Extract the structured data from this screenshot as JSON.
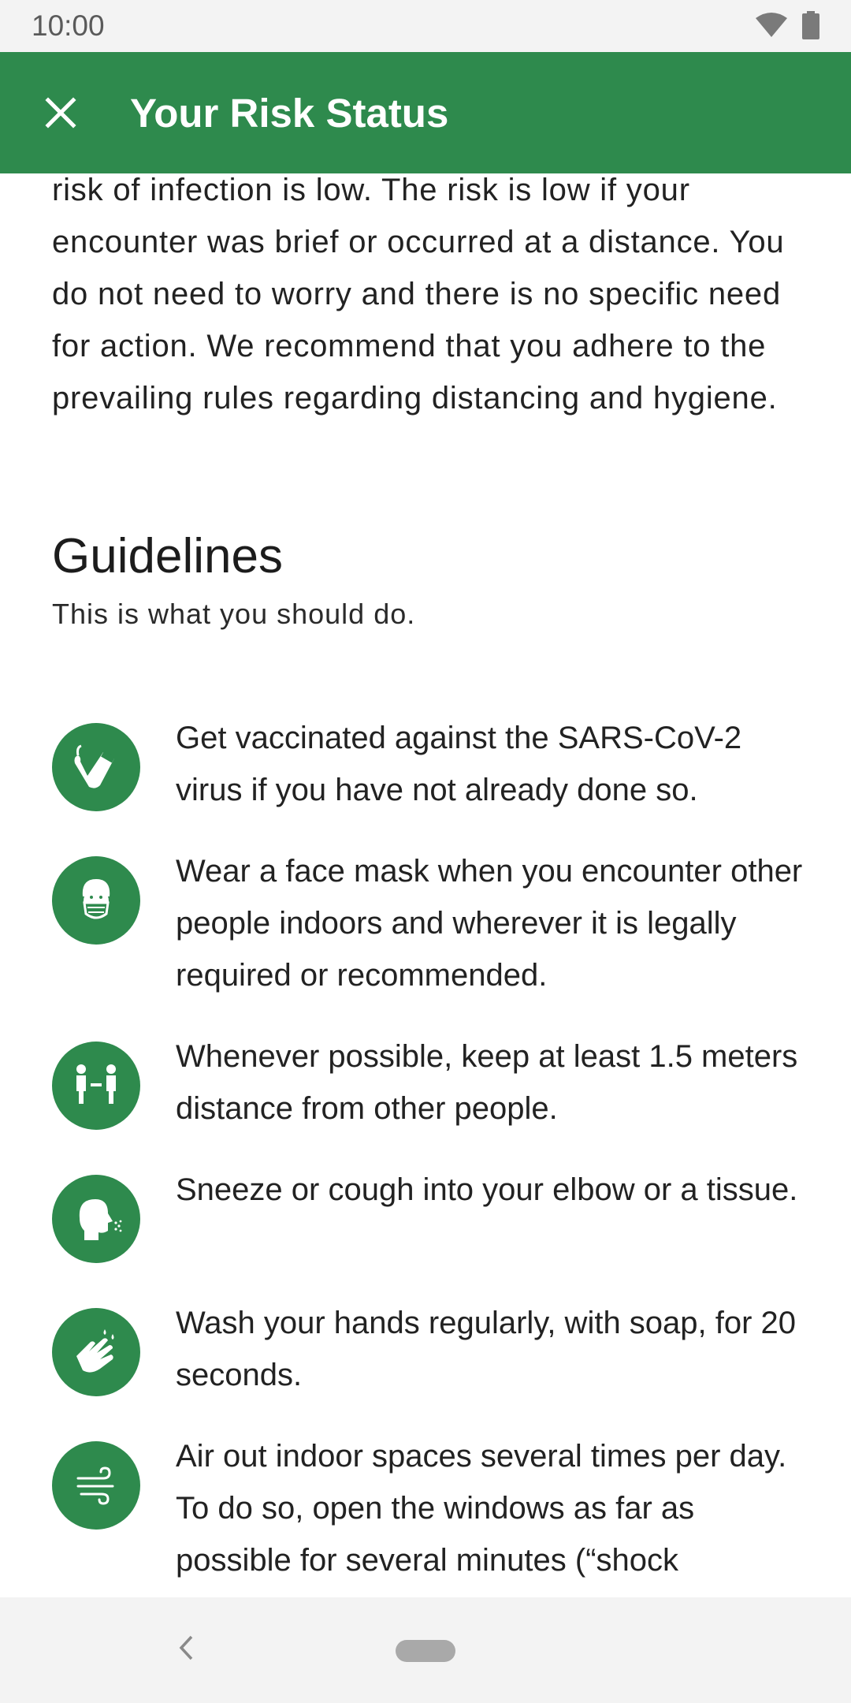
{
  "status_bar": {
    "time": "10:00",
    "icons": [
      "wifi-icon",
      "battery-icon"
    ]
  },
  "app_bar": {
    "title": "Your Risk Status",
    "close_icon": "close-icon",
    "color": "#2e8a4d"
  },
  "content": {
    "intro": "risk of infection is low. The risk is low if your encounter was brief or occurred at a distance. You do not need to worry and there is no specific need for action. We recommend that you adhere to the prevailing rules regarding distancing and hygiene.",
    "guidelines_title": "Guidelines",
    "guidelines_subtitle": "This is what you should do.",
    "guidelines": [
      {
        "icon": "vaccination-arm-icon",
        "text": "Get vaccinated against the SARS-CoV-2 virus if you have not already done so."
      },
      {
        "icon": "face-mask-icon",
        "text": "Wear a face mask when you encounter other people indoors and wherever it is legally required or recommended."
      },
      {
        "icon": "distance-people-icon",
        "text": "Whenever possible, keep at least 1.5 meters distance from other people."
      },
      {
        "icon": "sneeze-icon",
        "text": "Sneeze or cough into your elbow or a tissue."
      },
      {
        "icon": "hand-washing-icon",
        "text": "Wash your hands regularly, with soap, for 20 seconds."
      },
      {
        "icon": "air-ventilation-icon",
        "text": "Air out indoor spaces several times per day. To do so, open the windows as far as possible for several minutes (“shock"
      }
    ]
  },
  "nav_bar": {
    "back_icon": "back-chevron-icon",
    "home_icon": "home-pill-icon"
  }
}
